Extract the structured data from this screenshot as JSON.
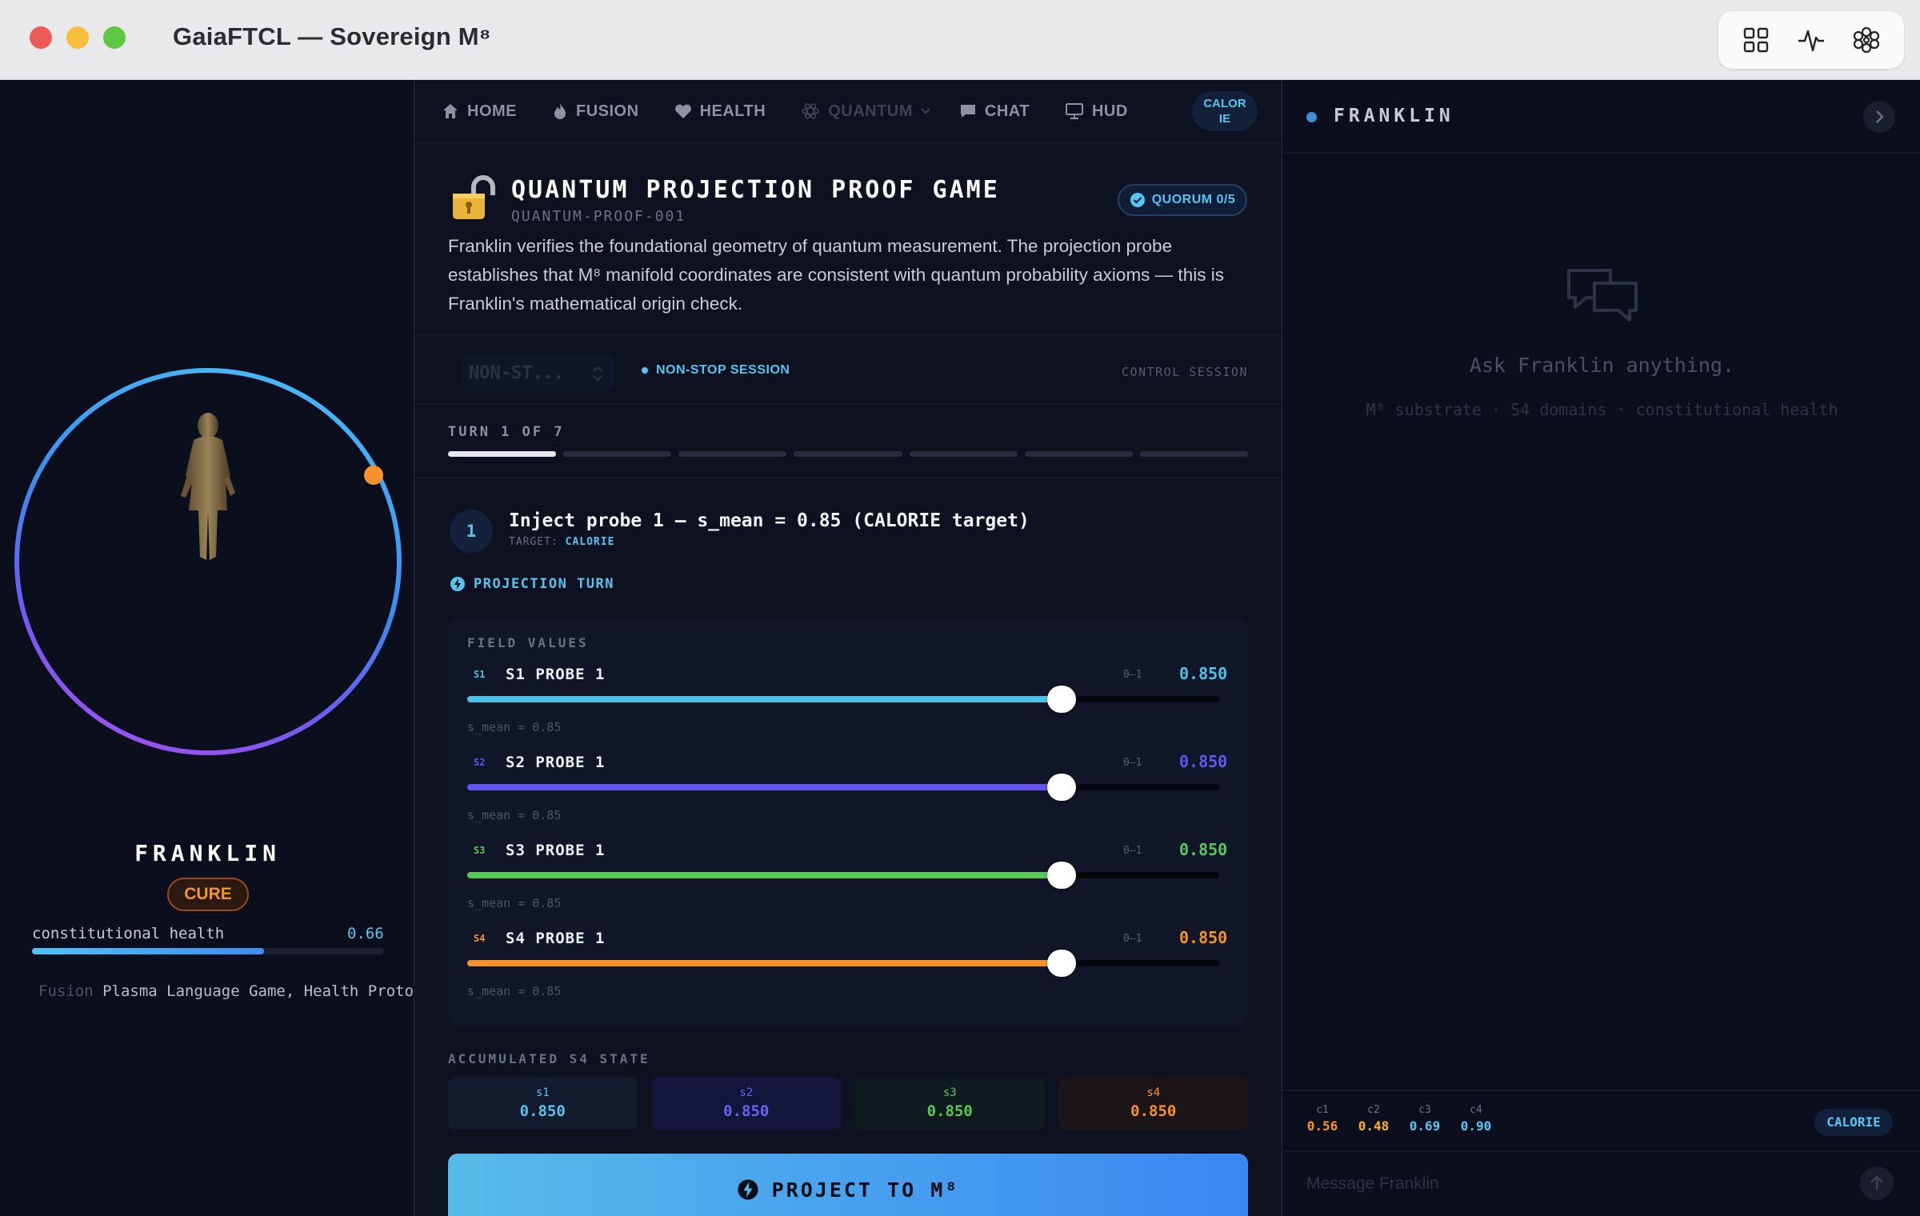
{
  "window": {
    "title": "GaiaFTCL — Sovereign M⁸"
  },
  "toolbar": {
    "icons": [
      "grid-icon",
      "pulse-icon",
      "flower-icon"
    ]
  },
  "left": {
    "agent_name": "FRANKLIN",
    "badge": "CURE",
    "health_label": "constitutional health",
    "health_value": "0.66",
    "health_fraction": 0.66,
    "ticker_fade": "Fusion",
    "ticker_text": " Plasma Language Game, Health Protoco"
  },
  "nav": {
    "items": [
      {
        "label": "HOME",
        "icon": "home-icon"
      },
      {
        "label": "FUSION",
        "icon": "flame-icon"
      },
      {
        "label": "HEALTH",
        "icon": "heart-icon"
      },
      {
        "label": "QUANTUM",
        "icon": "atom-icon"
      },
      {
        "label": "CHAT",
        "icon": "chat-icon"
      },
      {
        "label": "HUD",
        "icon": "monitor-icon"
      }
    ],
    "calorie_line1": "CALOR",
    "calorie_line2": "IE"
  },
  "game": {
    "title": "QUANTUM PROJECTION PROOF GAME",
    "id": "QUANTUM-PROOF-001",
    "quorum": "QUORUM 0/5",
    "description": "Franklin verifies the foundational geometry of quantum measurement. The projection probe establishes that M⁸ manifold coordinates are consistent with quantum probability axioms — this is Franklin's mathematical origin check."
  },
  "session": {
    "select_value": "NON-ST...",
    "live_label": "NON-STOP SESSION",
    "control_label": "CONTROL SESSION"
  },
  "turn": {
    "label": "TURN 1 OF 7",
    "current": 1,
    "total": 7
  },
  "step": {
    "number": "1",
    "title": "Inject probe 1 — s_mean = 0.85 (CALORIE target)",
    "target_label": "TARGET:",
    "target_value": "CALORIE",
    "mode": "PROJECTION TURN"
  },
  "fields": {
    "label": "FIELD VALUES",
    "items": [
      {
        "tag": "S1",
        "name": "S1 PROBE 1",
        "range": "0–1",
        "value": "0.850",
        "fraction": 0.85,
        "mean": "s_mean = 0.85",
        "color": "#4ec2e8"
      },
      {
        "tag": "S2",
        "name": "S2 PROBE 1",
        "range": "0–1",
        "value": "0.850",
        "fraction": 0.85,
        "mean": "s_mean = 0.85",
        "color": "#6655ee"
      },
      {
        "tag": "S3",
        "name": "S3 PROBE 1",
        "range": "0–1",
        "value": "0.850",
        "fraction": 0.85,
        "mean": "s_mean = 0.85",
        "color": "#5bc85a"
      },
      {
        "tag": "S4",
        "name": "S4 PROBE 1",
        "range": "0–1",
        "value": "0.850",
        "fraction": 0.85,
        "mean": "s_mean = 0.85",
        "color": "#f6922c"
      }
    ]
  },
  "accumulated": {
    "label": "ACCUMULATED S4 STATE",
    "cells": [
      {
        "key": "s1",
        "value": "0.850",
        "color": "#58c4f0",
        "bg": "#121a2e"
      },
      {
        "key": "s2",
        "value": "0.850",
        "color": "#6e60f2",
        "bg": "#14153a"
      },
      {
        "key": "s3",
        "value": "0.850",
        "color": "#5bc85a",
        "bg": "#0f1b1e"
      },
      {
        "key": "s4",
        "value": "0.850",
        "color": "#f6922c",
        "bg": "#1c1518"
      }
    ]
  },
  "project_button": "PROJECT TO M⁸",
  "chat": {
    "name": "FRANKLIN",
    "prompt": "Ask Franklin anything.",
    "subtitle": "M⁸ substrate · S4 domains · constitutional health",
    "stats": [
      {
        "key": "c1",
        "value": "0.56",
        "color": "#f6922c"
      },
      {
        "key": "c2",
        "value": "0.48",
        "color": "#f6b22c"
      },
      {
        "key": "c3",
        "value": "0.69",
        "color": "#58c4f0"
      },
      {
        "key": "c4",
        "value": "0.90",
        "color": "#58c4f0"
      }
    ],
    "calorie": "CALORIE",
    "placeholder": "Message Franklin"
  }
}
